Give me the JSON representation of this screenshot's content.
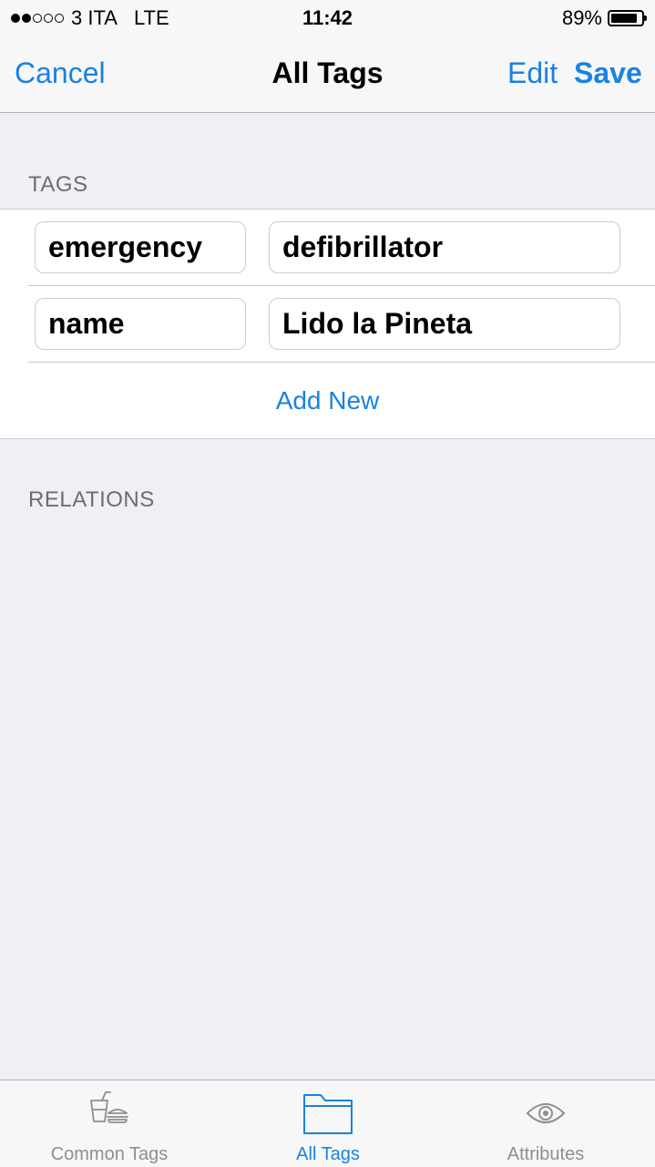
{
  "status_bar": {
    "carrier": "3 ITA",
    "network": "LTE",
    "time": "11:42",
    "battery_percent": "89%",
    "battery_level": 0.89,
    "signal_bars_filled": 2,
    "signal_bars_total": 5
  },
  "nav": {
    "cancel_label": "Cancel",
    "title": "All Tags",
    "edit_label": "Edit",
    "save_label": "Save"
  },
  "tags_section": {
    "header": "TAGS",
    "rows": [
      {
        "key": "emergency",
        "value": "defibrillator"
      },
      {
        "key": "name",
        "value": "Lido la Pineta"
      }
    ],
    "add_new_label": "Add New"
  },
  "relations_section": {
    "header": "RELATIONS"
  },
  "tab_bar": {
    "tabs": [
      {
        "label": "Common Tags",
        "icon": "drink-food-icon",
        "active": false
      },
      {
        "label": "All Tags",
        "icon": "folder-icon",
        "active": true
      },
      {
        "label": "Attributes",
        "icon": "eye-icon",
        "active": false
      }
    ]
  },
  "colors": {
    "accent": "#1A82E2",
    "inactive": "#8E8E93",
    "background": "#EFEFF4"
  }
}
